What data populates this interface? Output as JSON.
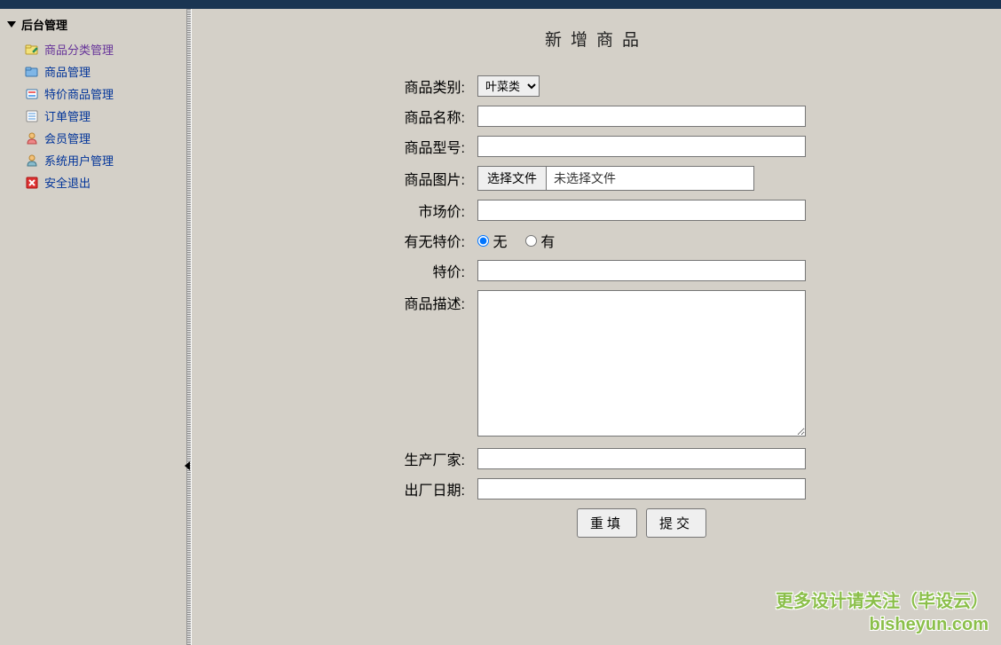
{
  "sidebar": {
    "header": "后台管理",
    "items": [
      {
        "label": "商品分类管理",
        "icon": "folder-edit-icon",
        "current": true
      },
      {
        "label": "商品管理",
        "icon": "folder-icon"
      },
      {
        "label": "特价商品管理",
        "icon": "tag-icon"
      },
      {
        "label": "订单管理",
        "icon": "list-icon"
      },
      {
        "label": "会员管理",
        "icon": "user-icon"
      },
      {
        "label": "系统用户管理",
        "icon": "admin-icon"
      },
      {
        "label": "安全退出",
        "icon": "exit-icon"
      }
    ]
  },
  "page": {
    "title": "新增商品"
  },
  "form": {
    "category": {
      "label": "商品类别:",
      "selected": "叶菜类"
    },
    "name": {
      "label": "商品名称:",
      "value": ""
    },
    "model": {
      "label": "商品型号:",
      "value": ""
    },
    "image": {
      "label": "商品图片:",
      "button": "选择文件",
      "status": "未选择文件"
    },
    "market_price": {
      "label": "市场价:",
      "value": ""
    },
    "has_discount": {
      "label": "有无特价:",
      "no": "无",
      "yes": "有",
      "value": "no"
    },
    "special_price": {
      "label": "特价:",
      "value": ""
    },
    "description": {
      "label": "商品描述:",
      "value": ""
    },
    "manufacturer": {
      "label": "生产厂家:",
      "value": ""
    },
    "production_date": {
      "label": "出厂日期:",
      "value": ""
    },
    "reset": "重填",
    "submit": "提交"
  },
  "watermark": {
    "line1": "更多设计请关注（毕设云）",
    "line2": "bisheyun.com"
  }
}
